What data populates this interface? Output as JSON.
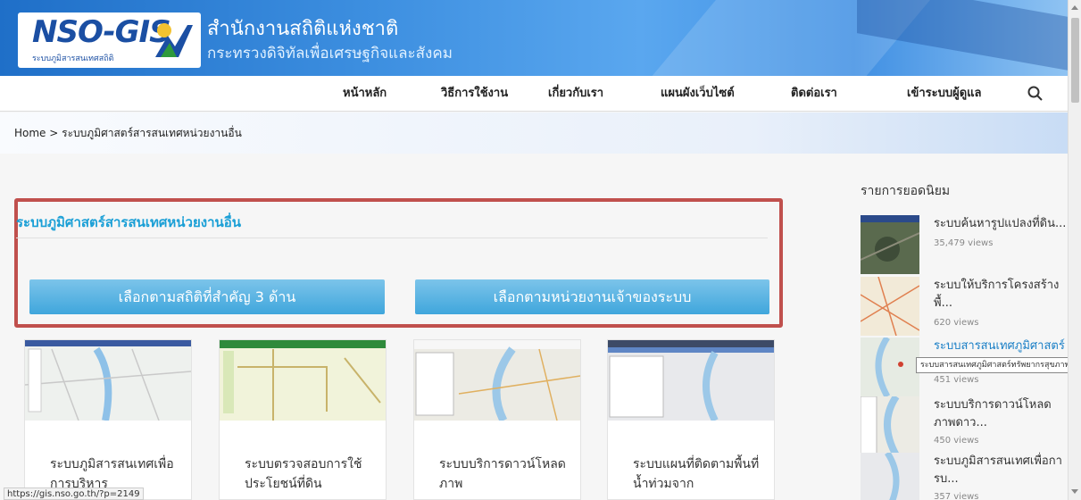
{
  "header": {
    "logo_text": "NSO-GIS",
    "logo_sub": "ระบบภูมิสารสนเทศสถิติ",
    "title": "สำนักงานสถิติแห่งชาติ",
    "subtitle": "กระทรวงดิจิทัลเพื่อเศรษฐกิจและสังคม"
  },
  "nav": {
    "items": [
      "หน้าหลัก",
      "วิธีการใช้งาน",
      "เกี่ยวกับเรา",
      "แผนผังเว็บไซต์",
      "ติดต่อเรา",
      "เข้าระบบผู้ดูแล"
    ],
    "search_icon": "search-icon"
  },
  "breadcrumb": {
    "home": "Home",
    "separator": ">",
    "current": "ระบบภูมิศาสตร์สารสนเทศหน่วยงานอื่น"
  },
  "main": {
    "section_title": "ระบบภูมิศาสตร์สารสนเทศหน่วยงานอื่น",
    "buttons": [
      "เลือกตามสถิติที่สำคัญ 3 ด้าน",
      "เลือกตามหน่วยงานเจ้าของระบบ"
    ],
    "cards": [
      {
        "title": "ระบบภูมิสารสนเทศเพื่อการบริหาร"
      },
      {
        "title": "ระบบตรวจสอบการใช้ประโยชน์ที่ดิน"
      },
      {
        "title": "ระบบบริการดาวน์โหลดภาพ"
      },
      {
        "title": "ระบบแผนที่ติดตามพื้นที่น้ำท่วมจาก"
      }
    ]
  },
  "sidebar": {
    "heading": "รายการยอดนิยม",
    "items": [
      {
        "title": "ระบบค้นหารูปแปลงที่ดิน...",
        "views": "35,479 views"
      },
      {
        "title": "ระบบให้บริการโครงสร้างพื้...",
        "views": "620 views"
      },
      {
        "title": "ระบบสารสนเทศภูมิศาสตร์",
        "views": "451 views"
      },
      {
        "title": "ระบบบริการดาวน์โหลดภาพดาว...",
        "views": "450 views"
      },
      {
        "title": "ระบบภูมิสารสนเทศเพื่อการบ...",
        "views": "357 views"
      }
    ],
    "tooltip": "ระบบสารสนเทศภูมิศาสตร์ทรัพยากรสุขภาพ"
  },
  "status": {
    "url": "https://gis.nso.go.th/?p=2149"
  },
  "colors": {
    "header_blue": "#2b7fd6",
    "section_title": "#1a9fd6",
    "button_blue": "#4aaade",
    "highlight_red": "#c0504d"
  }
}
